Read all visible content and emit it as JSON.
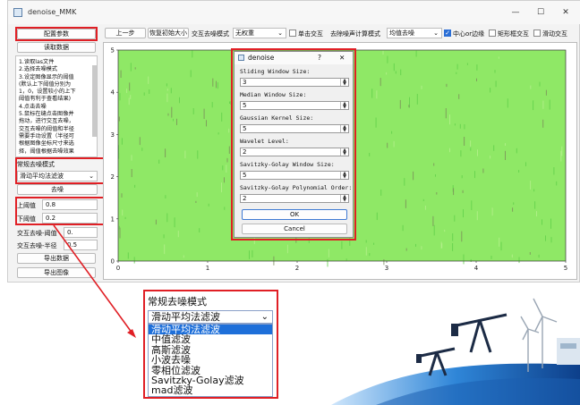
{
  "window": {
    "title": "denoise_MMK",
    "min_glyph": "—",
    "max_glyph": "☐",
    "close_glyph": "✕"
  },
  "left": {
    "config_button": "配置参数",
    "read_button": "读取数据",
    "instructions": [
      "1.读取las文件",
      "2.选择去噪模式",
      "3.设定图像显示的阈值",
      "(默认上下阈值分别为",
      "1，0，设置较小的上下",
      "阈值有利于查看结果)",
      "4.点击去噪",
      "5.鼠标在缝点击图像并",
      "拖动，进行交互去噪，",
      "交互去噪的阈值和半径",
      "需要手动设置（半径可",
      "根据图像坐标尺寸来选",
      "择，阈值根据去噪效果"
    ],
    "mode_label": "常规去噪模式",
    "mode_value": "滑动平均法滤波",
    "denoise_button": "去噪",
    "upper_label": "上阈值",
    "upper_value": "0.8",
    "lower_label": "下阈值",
    "lower_value": "0.2",
    "interactive_threshold_label": "交互去噪-阈值",
    "interactive_threshold_value": "0.",
    "interactive_radius_label": "交互去噪-半径",
    "interactive_radius_value": "0.5",
    "export_data_button": "导出数据",
    "export_image_button": "导出图像"
  },
  "toolbar": {
    "undo_button": "上一步",
    "reset_button": "恢复初始大小",
    "interactive_mode_label": "交互去噪模式",
    "interactive_mode_value": "无权重",
    "single_click_label": "单击交互",
    "noise_calc_label": "去除噪声计算模式",
    "noise_calc_value": "均值去噪",
    "center_edge_label": "中心or边缘",
    "rect_label": "矩形框交互",
    "slide_label": "滑动交互"
  },
  "toolbar_checks": {
    "single_click": false,
    "center_edge": true,
    "rect": false,
    "slide": false
  },
  "plot": {
    "y_ticks": [
      "5",
      "4",
      "3",
      "2",
      "1",
      "0"
    ],
    "x_ticks": [
      "0",
      "1",
      "2",
      "3",
      "4",
      "5"
    ],
    "background_color": "#8fe866",
    "xlim": [
      0,
      5
    ],
    "ylim": [
      0,
      5
    ]
  },
  "dialog": {
    "title": "denoise",
    "help_glyph": "?",
    "close_glyph": "✕",
    "fields": [
      {
        "label": "Sliding Window Size:",
        "value": "3"
      },
      {
        "label": "Median Window Size:",
        "value": "5"
      },
      {
        "label": "Gaussian Kernel Size:",
        "value": "5"
      },
      {
        "label": "Wavelet Level:",
        "value": "2"
      },
      {
        "label": "Savitzky-Golay Window Size:",
        "value": "5"
      },
      {
        "label": "Savitzky-Golay Polynomial Order:",
        "value": "2"
      }
    ],
    "ok_button": "OK",
    "cancel_button": "Cancel"
  },
  "zoom": {
    "title": "常规去噪模式",
    "selected": "滑动平均法滤波",
    "options": [
      "滑动平均法滤波",
      "中值滤波",
      "高斯滤波",
      "小波去噪",
      "零相位滤波",
      "Savitzky-Golay滤波",
      "mad滤波"
    ]
  },
  "colors": {
    "highlight_red": "#e01f25",
    "accent_blue": "#1e6fd9"
  }
}
